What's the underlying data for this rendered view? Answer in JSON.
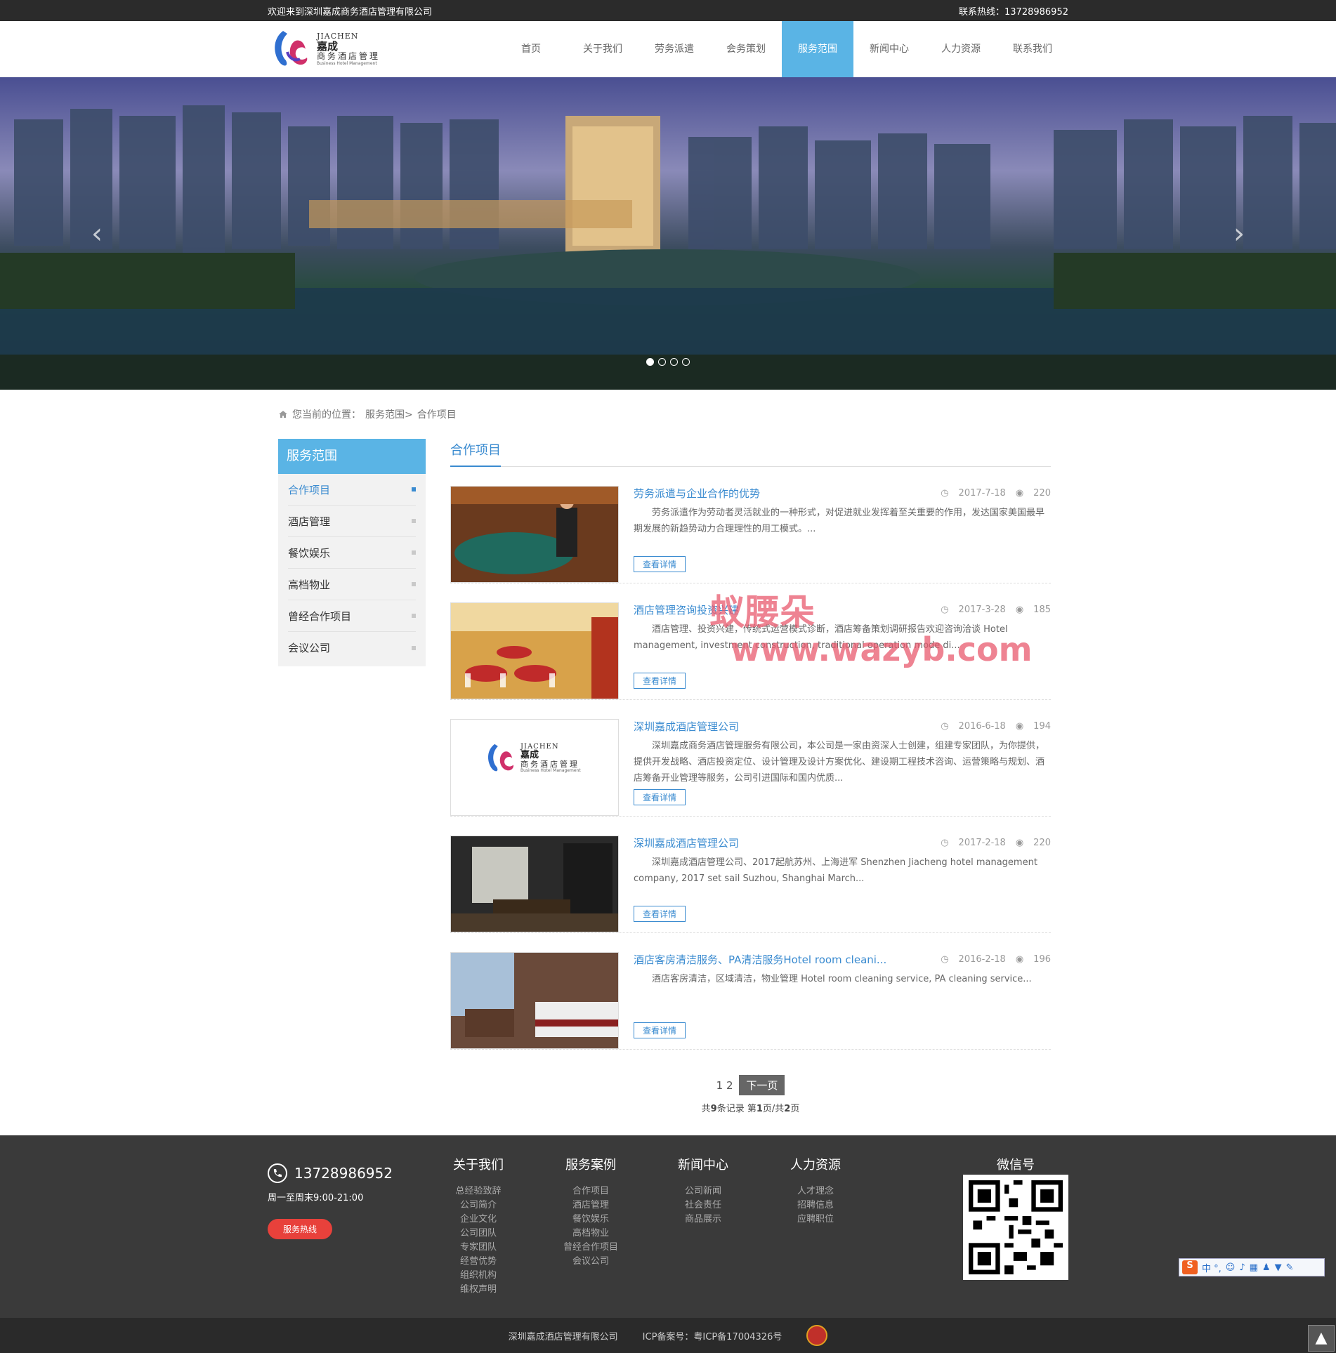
{
  "topbar": {
    "welcome": "欢迎来到深圳嘉成商务酒店管理有限公司",
    "hotline_label": "联系热线：13728986952"
  },
  "logo": {
    "en": "JIACHEN",
    "cn": "嘉成",
    "cn2": "商务酒店管理",
    "sub": "Business Hotel Management"
  },
  "nav": [
    "首页",
    "关于我们",
    "劳务派遣",
    "会务策划",
    "服务范围",
    "新闻中心",
    "人力资源",
    "联系我们"
  ],
  "nav_active_index": 4,
  "banner": {
    "prev": "‹",
    "next": "›",
    "slides": 4,
    "active_slide": 1
  },
  "breadcrumb": {
    "label": "您当前的位置：",
    "path1": "服务范围>",
    "path2": "合作项目"
  },
  "sidebar": {
    "title": "服务范围",
    "items": [
      "合作项目",
      "酒店管理",
      "餐饮娱乐",
      "高档物业",
      "曾经合作项目",
      "会议公司"
    ],
    "active_index": 0
  },
  "main": {
    "title": "合作项目",
    "more_label": "查看详情",
    "items": [
      {
        "title": "劳务派遣与企业合作的优势",
        "date": "2017-7-18",
        "views": "220",
        "desc": "劳务派遣作为劳动者灵活就业的一种形式，对促进就业发挥着至关重要的作用，发达国家美国最早期发展的新趋势动力合理理性的用工模式。..."
      },
      {
        "title": "酒店管理咨询投资兴建",
        "date": "2017-3-28",
        "views": "185",
        "desc": "酒店管理、投资兴建，传统式运营模式诊断，酒店筹备策划调研报告欢迎咨询洽谈 Hotel management, investment construction, traditional operation mode di..."
      },
      {
        "title": "深圳嘉成酒店管理公司",
        "date": "2016-6-18",
        "views": "194",
        "desc": "深圳嘉成商务酒店管理服务有限公司，本公司是一家由资深人士创建，组建专家团队，为你提供，提供开发战略、酒店投资定位、设计管理及设计方案优化、建设期工程技术咨询、运营策略与规划、酒店筹备开业管理等服务，公司引进国际和国内优质..."
      },
      {
        "title": "深圳嘉成酒店管理公司",
        "date": "2017-2-18",
        "views": "220",
        "desc": "深圳嘉成酒店管理公司、2017起航苏州、上海进军 Shenzhen Jiacheng hotel management company, 2017 set sail Suzhou, Shanghai March..."
      },
      {
        "title": "酒店客房清洁服务、PA清洁服务Hotel room cleani...",
        "date": "2016-2-18",
        "views": "196",
        "desc": "酒店客房清洁，区域清洁，物业管理 Hotel room cleaning service, PA cleaning service..."
      }
    ]
  },
  "pager": {
    "pages": "1 2",
    "next": "下一页",
    "info_pre": "共",
    "total": "9",
    "info_mid": "条记录 第",
    "current": "1",
    "info_mid2": "页/共",
    "pages_total": "2",
    "info_end": "页"
  },
  "footer": {
    "phone": "13728986952",
    "hours": "周一至周末9:00-21:00",
    "hotline_btn": "服务热线",
    "cols": [
      {
        "title": "关于我们",
        "links": [
          "总经验致辞",
          "公司简介",
          "企业文化",
          "公司团队",
          "专家团队",
          "经营优势",
          "组织机构",
          "维权声明"
        ]
      },
      {
        "title": "服务案例",
        "links": [
          "合作项目",
          "酒店管理",
          "餐饮娱乐",
          "高档物业",
          "曾经合作项目",
          "会议公司"
        ]
      },
      {
        "title": "新闻中心",
        "links": [
          "公司新闻",
          "社会责任",
          "商品展示"
        ]
      },
      {
        "title": "人力资源",
        "links": [
          "人才理念",
          "招聘信息",
          "应聘职位"
        ]
      }
    ],
    "wechat_title": "微信号"
  },
  "bottom": {
    "company": "深圳嘉成酒店管理有限公司",
    "icp_label": "ICP备案号：",
    "icp": "粤ICP备17004326号"
  },
  "watermark": {
    "cn": "蚁腰朵",
    "url": "www.wazyb.com"
  },
  "ime": {
    "label": "中 °,"
  },
  "colors": {
    "accent": "#5ab4e5",
    "link": "#3a8bd0",
    "topbar": "#2b2b2b",
    "footer": "#3a3a3a",
    "hotline": "#e8413b"
  }
}
